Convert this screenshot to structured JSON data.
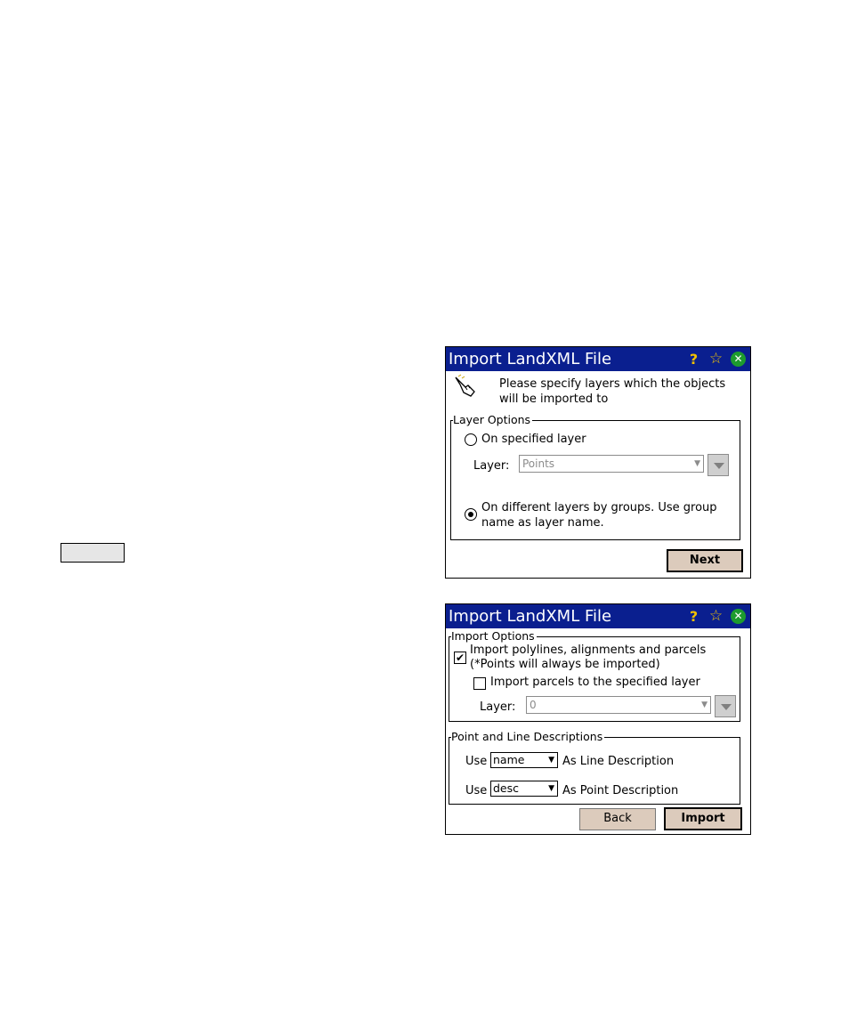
{
  "dialog1": {
    "title": "Import LandXML File",
    "message": "Please specify layers which the objects will be imported to",
    "group_label": "Layer Options",
    "option_specified": "On specified layer",
    "layer_label": "Layer:",
    "layer_value": "Points",
    "option_groups": "On different layers by groups. Use group name as layer name.",
    "next_label": "Next"
  },
  "dialog2": {
    "title": "Import LandXML File",
    "group1_label": "Import Options",
    "import_polylines_label": "Import polylines, alignments and parcels (*Points will always be imported)",
    "import_parcels_label": "Import parcels to the specified layer",
    "layer_label": "Layer:",
    "layer_value": "0",
    "group2_label": "Point and Line Descriptions",
    "use_label": "Use",
    "line_desc_value": "name",
    "line_desc_label": "As Line Description",
    "point_desc_value": "desc",
    "point_desc_label": "As Point Description",
    "back_label": "Back",
    "import_label": "Import"
  },
  "state": {
    "option_specified_selected": false,
    "option_groups_selected": true,
    "import_polylines_checked": true,
    "import_parcels_checked": false
  },
  "icons": {
    "titlebar": [
      "help-icon",
      "favorite-icon",
      "close-icon"
    ],
    "dialog1_header": "pointing-hand-icon"
  },
  "colors": {
    "titlebar": "#0a1f8f",
    "button_face": "#dccbbc",
    "close_icon": "#1d9b2e"
  }
}
